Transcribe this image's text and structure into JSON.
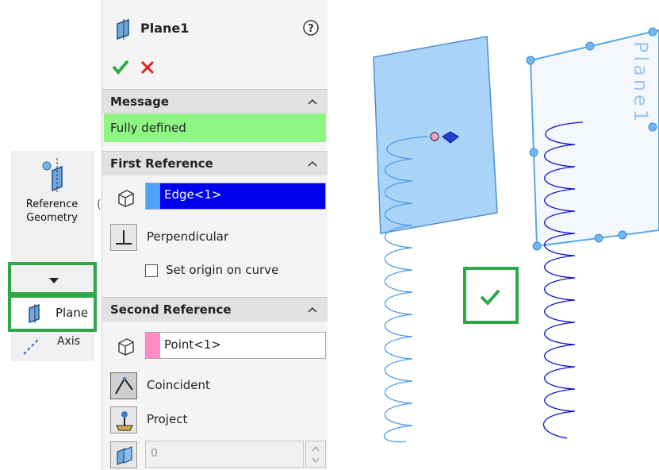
{
  "toolbar": {
    "group_label_line1": "Reference",
    "group_label_line2": "Geometry",
    "plane_item": "Plane",
    "axis_item": "Axis"
  },
  "panel": {
    "title": "Plane1",
    "message_section": "Message",
    "message_text": "Fully defined",
    "first_ref": {
      "header": "First Reference",
      "selection": "Edge<1>",
      "constraint": "Perpendicular",
      "option_label": "Set origin on curve",
      "option_checked": false
    },
    "second_ref": {
      "header": "Second Reference",
      "selection": "Point<1>",
      "constraint_1": "Coincident",
      "constraint_2": "Project",
      "spin_value": "0"
    }
  },
  "viewport": {
    "plane_tag": "Plane1"
  },
  "colors": {
    "accent_green": "#2fa84a",
    "message_bg": "#8ef783",
    "selection_blue": "#0000ee",
    "first_ref_strip": "#4aa3ff",
    "second_ref_strip": "#ff8cc6",
    "plane_fill": "#a9d4f7",
    "helix_light": "#4e9ce6",
    "helix_dark": "#1010cc"
  }
}
